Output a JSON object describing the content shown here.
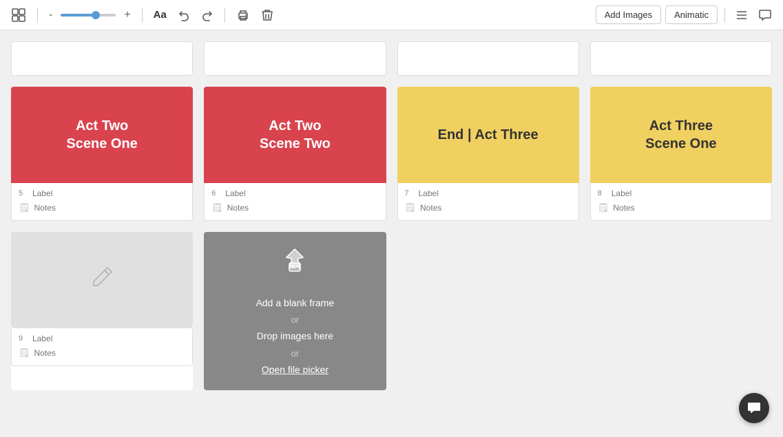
{
  "toolbar": {
    "grid_icon": "▦",
    "zoom_minus": "-",
    "zoom_plus": "+",
    "undo_label": "↩",
    "redo_label": "↪",
    "font_label": "Aa",
    "print_icon": "🖨",
    "trash_icon": "🗑",
    "add_images_label": "Add Images",
    "animatic_label": "Animatic",
    "list_icon": "☰",
    "chat_icon": "💬"
  },
  "cards_row1": [
    {
      "number": "5",
      "title": "Act Two\nScene One",
      "color": "red",
      "label_placeholder": "Label",
      "notes_placeholder": "Notes"
    },
    {
      "number": "6",
      "title": "Act Two\nScene Two",
      "color": "red",
      "label_placeholder": "Label",
      "notes_placeholder": "Notes"
    },
    {
      "number": "7",
      "title": "End | Act Three",
      "color": "yellow",
      "label_placeholder": "Label",
      "notes_placeholder": "Notes"
    },
    {
      "number": "8",
      "title": "Act Three\nScene One",
      "color": "yellow",
      "label_placeholder": "Label",
      "notes_placeholder": "Notes"
    }
  ],
  "cards_row2": [
    {
      "number": "9",
      "color": "gray",
      "label_placeholder": "Label",
      "notes_placeholder": "Notes"
    }
  ],
  "drop_zone": {
    "main_text": "Add a blank frame",
    "or1": "or",
    "drop_text": "Drop images here",
    "or2": "or",
    "link_text": "Open file picker"
  },
  "fab": {
    "icon": "💬"
  }
}
